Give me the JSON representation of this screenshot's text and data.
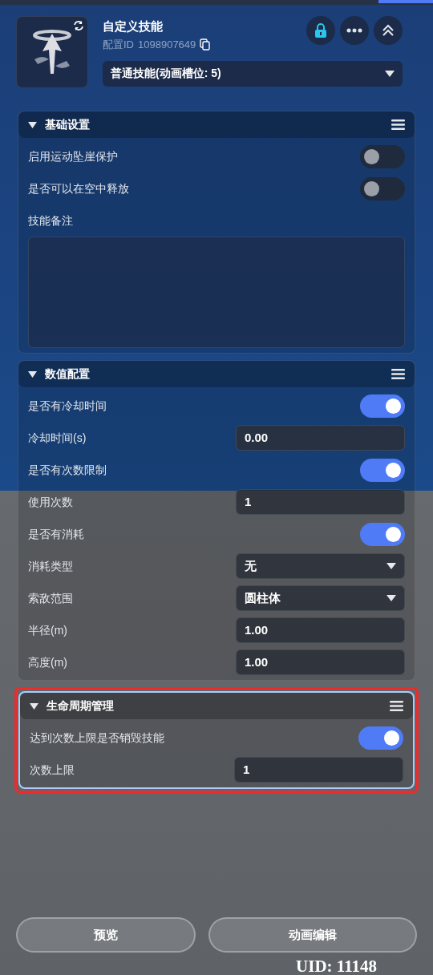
{
  "header": {
    "title": "自定义技能",
    "config_id_label": "配置ID",
    "config_id": "1098907649",
    "skill_type": "普通技能(动画槽位: 5)"
  },
  "sections": [
    {
      "title": "基础设置",
      "expanded": true,
      "highlighted": false,
      "rows": [
        {
          "kind": "toggle",
          "label": "启用运动坠崖保护",
          "on": false
        },
        {
          "kind": "toggle",
          "label": "是否可以在空中释放",
          "on": false
        },
        {
          "kind": "textarea",
          "label": "技能备注"
        }
      ]
    },
    {
      "title": "数值配置",
      "expanded": true,
      "highlighted": false,
      "rows": [
        {
          "kind": "toggle",
          "label": "是否有冷却时间",
          "on": true
        },
        {
          "kind": "input",
          "label": "冷却时间(s)",
          "value": "0.00"
        },
        {
          "kind": "toggle",
          "label": "是否有次数限制",
          "on": true
        },
        {
          "kind": "input",
          "label": "使用次数",
          "value": "1"
        },
        {
          "kind": "toggle",
          "label": "是否有消耗",
          "on": true
        },
        {
          "kind": "select",
          "label": "消耗类型",
          "value": "无"
        },
        {
          "kind": "select",
          "label": "索敌范围",
          "value": "圆柱体"
        },
        {
          "kind": "input",
          "label": "半径(m)",
          "value": "1.00"
        },
        {
          "kind": "input",
          "label": "高度(m)",
          "value": "1.00"
        }
      ]
    },
    {
      "title": "生命周期管理",
      "expanded": true,
      "highlighted": true,
      "rows": [
        {
          "kind": "toggle",
          "label": "达到次数上限是否销毁技能",
          "on": true
        },
        {
          "kind": "input",
          "label": "次数上限",
          "value": "1"
        }
      ]
    }
  ],
  "buttons": [
    "预览",
    "动画编辑"
  ],
  "uid": "UID: 11148"
}
